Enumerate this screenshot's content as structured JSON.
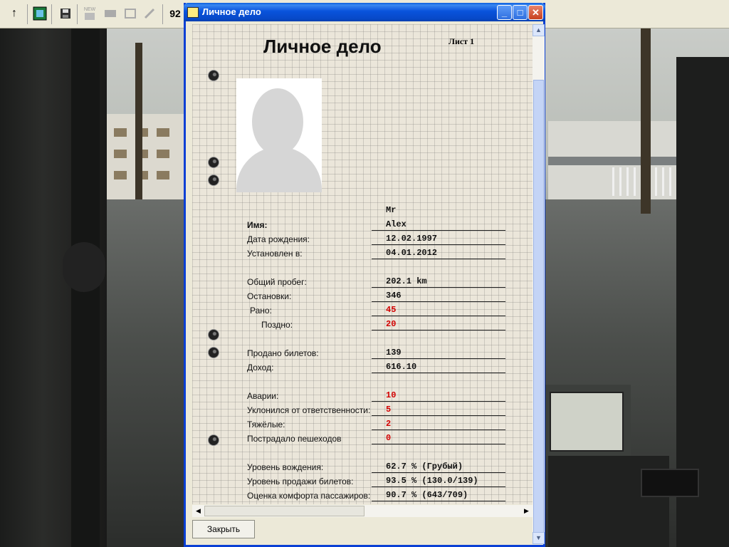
{
  "window": {
    "title": "Личное дело",
    "minimize_label": "_",
    "maximize_label": "□",
    "close_label": "✕"
  },
  "toolbar": {
    "up_icon": "↑",
    "new_label": "NEW",
    "counter_label": "92"
  },
  "dossier": {
    "title": "Личное дело",
    "sheet": "Лист 1",
    "rows": [
      {
        "label": "",
        "value": "Mr"
      },
      {
        "label": "Имя:",
        "value": "Alex"
      },
      {
        "label": "Дата рождения:",
        "value": "12.02.1997"
      },
      {
        "label": "Установлен в:",
        "value": "04.01.2012"
      },
      {
        "label": "Общий пробег:",
        "value": "202.1 km"
      },
      {
        "label": "Остановки:",
        "value": "346"
      },
      {
        "label": "Рано:",
        "value": "45"
      },
      {
        "label": "Поздно:",
        "value": "20"
      },
      {
        "label": "Продано билетов:",
        "value": "139"
      },
      {
        "label": "Доход:",
        "value": "616.10"
      },
      {
        "label": "Аварии:",
        "value": "10"
      },
      {
        "label": "Уклонился от ответственности:",
        "value": "5"
      },
      {
        "label": "Тяжёлые:",
        "value": "2"
      },
      {
        "label": "Пострадало пешеходов",
        "value": "0"
      },
      {
        "label": "Уровень вождения:",
        "value": "62.7 % (Грубый)"
      },
      {
        "label": "Уровень продажи билетов:",
        "value": "93.5 % (130.0/139)"
      },
      {
        "label": "Оценка комфорта пассажиров:",
        "value": "90.7 % (643/709)"
      }
    ]
  },
  "buttons": {
    "close": "Закрыть"
  },
  "colors": {
    "title_bar": "#0953dc",
    "warning_value": "#d20000",
    "paper": "#ebe6da"
  }
}
